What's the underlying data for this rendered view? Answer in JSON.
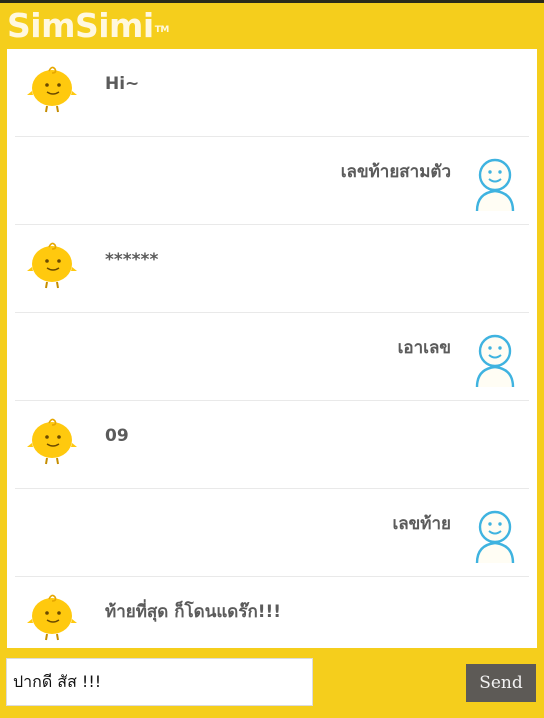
{
  "app": {
    "logo_text": "SimSimi",
    "logo_tm": "TM"
  },
  "colors": {
    "brand_yellow": "#f5ce1c",
    "bot_face": "#ffc90e",
    "user_icon": "#3fb3e0",
    "send_button": "#5d5a56"
  },
  "messages": [
    {
      "sender": "bot",
      "text": "Hi~",
      "avatar_icon": "simsimi-chick-icon"
    },
    {
      "sender": "user",
      "text": "เลขท้ายสามตัว",
      "avatar_icon": "user-avatar-icon"
    },
    {
      "sender": "bot",
      "text": "******",
      "avatar_icon": "simsimi-chick-icon"
    },
    {
      "sender": "user",
      "text": "เอาเลข",
      "avatar_icon": "user-avatar-icon"
    },
    {
      "sender": "bot",
      "text": "09",
      "avatar_icon": "simsimi-chick-icon"
    },
    {
      "sender": "user",
      "text": "เลขท้าย",
      "avatar_icon": "user-avatar-icon"
    },
    {
      "sender": "bot",
      "text": "ท้ายที่สุด ก็โดนแดร๊ก!!!",
      "avatar_icon": "simsimi-chick-icon"
    }
  ],
  "composer": {
    "input_value": "ปากดี สัส !!!",
    "send_label": "Send"
  }
}
